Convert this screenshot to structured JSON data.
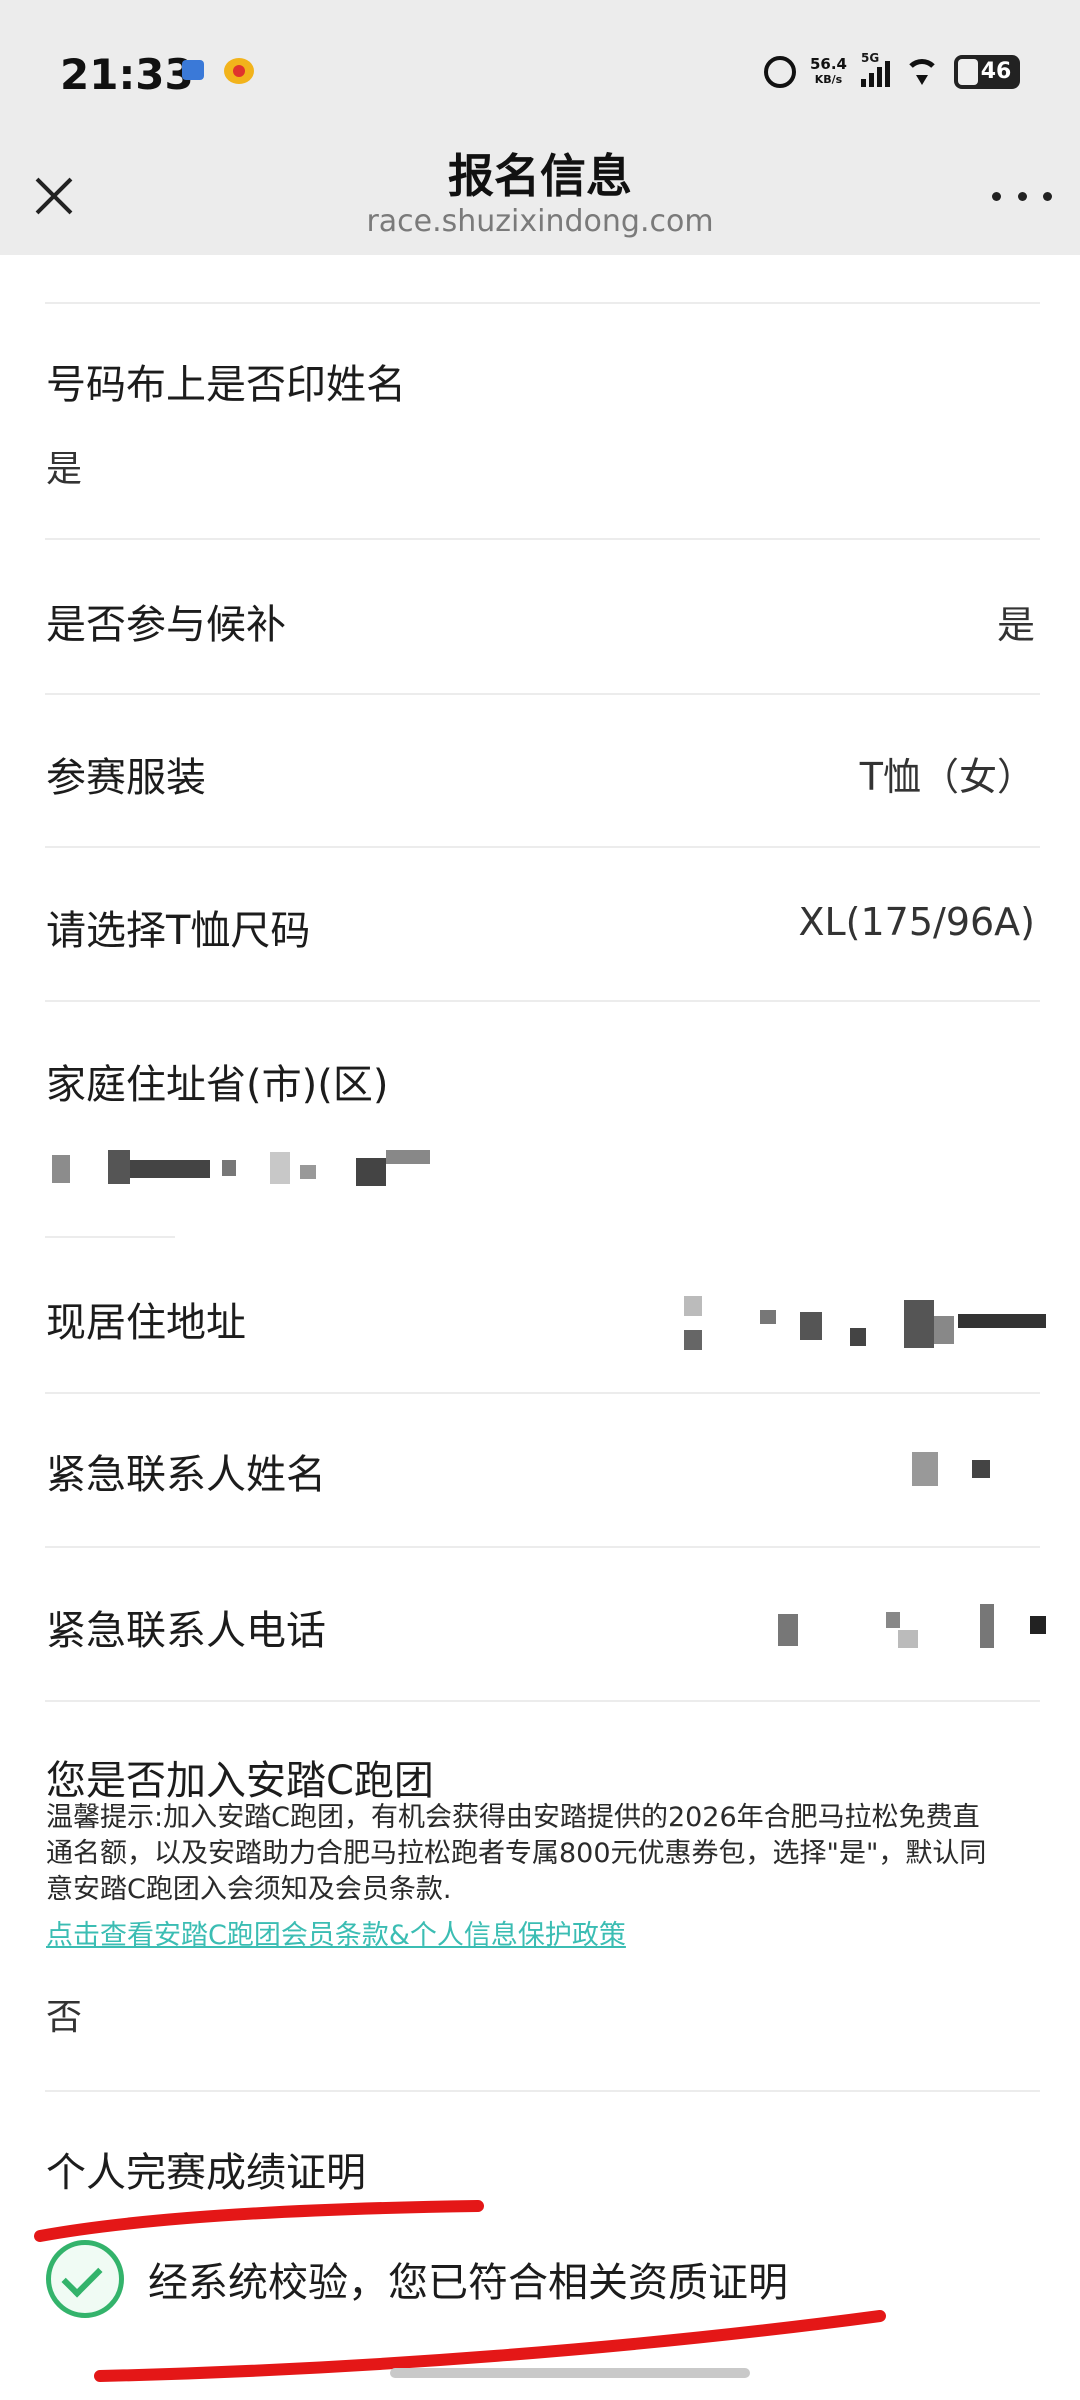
{
  "status_bar": {
    "time": "21:33",
    "net_speed_value": "56.4",
    "net_speed_unit": "KB/s",
    "signal_label": "5G",
    "battery": "46",
    "icons": [
      "notification-icon",
      "weibo-icon",
      "alarm-icon",
      "signal-icon",
      "wifi-icon",
      "battery-icon"
    ]
  },
  "header": {
    "title": "报名信息",
    "url": "race.shuzixindong.com",
    "close_icon": "close-icon",
    "more_icon": "more-icon"
  },
  "fields": {
    "bib_name": {
      "label": "号码布上是否印姓名",
      "value": "是"
    },
    "waitlist": {
      "label": "是否参与候补",
      "value": "是"
    },
    "apparel": {
      "label": "参赛服装",
      "value": "T恤（女）"
    },
    "tshirt_size": {
      "label": "请选择T恤尺码",
      "value": "XL(175/96A)"
    },
    "home_address": {
      "label": "家庭住址省(市)(区)"
    },
    "current_address": {
      "label": "现居住地址"
    },
    "emergency_name": {
      "label": "紧急联系人姓名"
    },
    "emergency_phone": {
      "label": "紧急联系人电话"
    },
    "anta_club": {
      "label": "您是否加入安踏C跑团",
      "hint": "温馨提示:加入安踏C跑团，有机会获得由安踏提供的2026年合肥马拉松免费直通名额，以及安踏助力合肥马拉松跑者专属800元优惠券包，选择\"是\"，默认同意安踏C跑团入会须知及会员条款.",
      "link": "点击查看安踏C跑团会员条款&个人信息保护政策",
      "value": "否"
    },
    "race_proof": {
      "label": "个人完赛成绩证明",
      "verify_text": "经系统校验，您已符合相关资质证明"
    }
  },
  "colors": {
    "header_bg": "#ececec",
    "link": "#3bbdb3",
    "success": "#33b36b",
    "annotation": "#e41717"
  }
}
